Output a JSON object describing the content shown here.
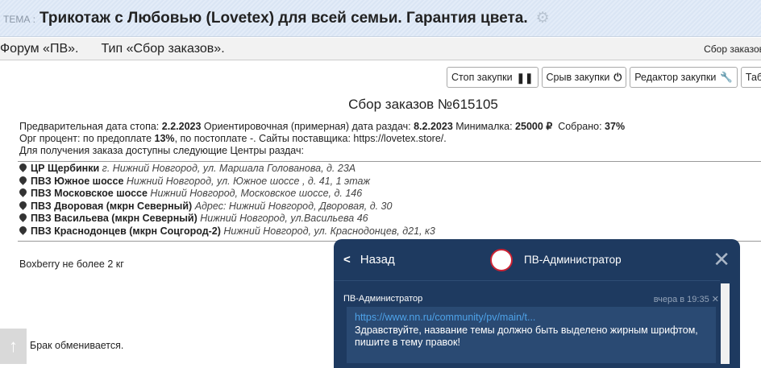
{
  "topic": {
    "label": "ТЕМА :",
    "title": "Трикотаж с Любовью (Lovetex) для всей семьи. Гарантия цвета."
  },
  "forum": {
    "forum": "Форум «ПВ».",
    "type": "Тип «Сбор заказов».",
    "right": "Сбор заказов"
  },
  "buttons": [
    {
      "label": "Стоп закупки",
      "icon": "pause-icon"
    },
    {
      "label": "Срыв закупки",
      "icon": "power-icon"
    },
    {
      "label": "Редактор закупки",
      "icon": "wrench-icon"
    },
    {
      "label": "Таблица"
    }
  ],
  "heading": "Сбор заказов №615105",
  "info": {
    "stop_label": "Предварительная дата стопа:",
    "stop": "2.2.2023",
    "dist_label": "Ориентировочная (примерная) дата раздач:",
    "dist": "8.2.2023",
    "min_label": "Минималка:",
    "min": "25000 ₽",
    "collected_label": "Собрано:",
    "collected": "37%",
    "org_pre": "Орг процент: по предоплате",
    "org_pct": "13%",
    "org_post": ", по постоплате -. Сайты поставщика: https://lovetex.store/.",
    "centers": "Для получения заказа доступны следующие Центры раздач:"
  },
  "points": [
    {
      "name": "ЦР Щербинки",
      "addr": "г. Нижний Новгород, ул. Маршала Голованова, д. 23А"
    },
    {
      "name": "ПВЗ Южное шоссе",
      "addr": "Нижний Новгород, ул. Южное шоссе , д. 41, 1 этаж"
    },
    {
      "name": "ПВЗ Московское шоссе",
      "addr": "Нижний Новгород, Московское шоссе, д. 146"
    },
    {
      "name": "ПВЗ Дворовая (мкрн Северный)",
      "addr": "Адрес: Нижний Новгород, Дворовая, д. 30"
    },
    {
      "name": "ПВЗ Васильева (мкрн Северный)",
      "addr": "Нижний Новгород, ул.Васильева 46"
    },
    {
      "name": "ПВЗ Краснодонцев (мкрн Соцгород-2)",
      "addr": "Нижний Новгород, ул. Краснодонцев, д21, к3"
    }
  ],
  "notes": {
    "boxberry": "Boxberry не более 2 кг",
    "defect": "Брак обменивается."
  },
  "chat": {
    "back": "Назад",
    "name": "ПВ-Администратор",
    "sender": "ПВ-Администратор",
    "time": "вчера в 19:35",
    "link": "https://www.nn.ru/community/pv/main/t...",
    "text": "Здравствуйте, название темы должно быть выделено жирным шрифтом, пишите в тему правок!"
  }
}
